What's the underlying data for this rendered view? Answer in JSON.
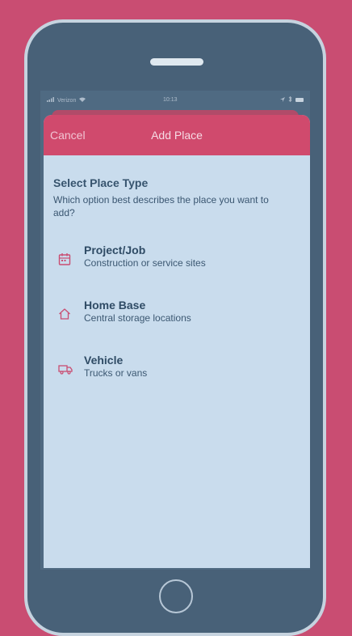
{
  "status_bar": {
    "carrier": "Verizon",
    "time": "10:13"
  },
  "nav": {
    "cancel_label": "Cancel",
    "title": "Add Place"
  },
  "section": {
    "title": "Select Place Type",
    "description": "Which option best describes the place you want to add?"
  },
  "options": [
    {
      "name": "Project/Job",
      "subtitle": "Construction or service sites",
      "icon": "calendar-icon"
    },
    {
      "name": "Home Base",
      "subtitle": "Central storage locations",
      "icon": "home-icon"
    },
    {
      "name": "Vehicle",
      "subtitle": "Trucks or vans",
      "icon": "truck-icon"
    }
  ],
  "colors": {
    "background": "#c94d72",
    "nav_bar": "#d04a6d",
    "screen": "#c9dced",
    "icon_accent": "#c94d72",
    "phone_body": "#486178"
  }
}
